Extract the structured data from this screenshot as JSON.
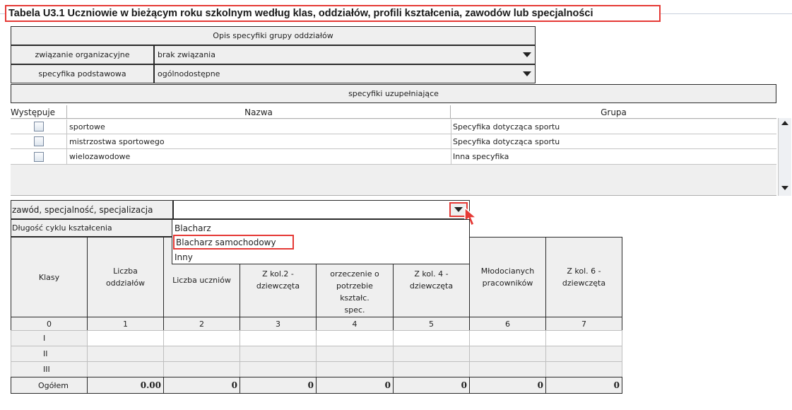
{
  "title": "Tabela U3.1 Uczniowie w bieżącym roku szkolnym według klas, oddziałów, profili kształcenia, zawodów lub specjalności",
  "group_desc": {
    "header": "Opis specyfiki grupy oddziałów",
    "org_label": "związanie organizacyjne",
    "org_value": "brak związania",
    "spec_label": "specyfika podstawowa",
    "spec_value": "ogólnodostępne",
    "supp_header": "specyfiki uzupełniające"
  },
  "spec_table": {
    "columns": [
      "Występuje",
      "Nazwa",
      "Grupa"
    ],
    "rows": [
      {
        "checked": false,
        "name": "sportowe",
        "group": "Specyfika dotycząca sportu"
      },
      {
        "checked": false,
        "name": "mistrzostwa sportowego",
        "group": "Specyfika dotycząca sportu"
      },
      {
        "checked": false,
        "name": "wielozawodowe",
        "group": "Inna specyfika"
      }
    ]
  },
  "profession": {
    "label": "zawód, specjalność, specjalizacja",
    "value": "",
    "cycle_label": "Długość cyklu kształcenia",
    "options": [
      "Blacharz",
      "Blacharz samochodowy",
      "Inny"
    ],
    "highlighted_option": "Blacharz samochodowy"
  },
  "students_table": {
    "headers": [
      "Klasy",
      "Liczba oddziałów",
      "Liczba uczniów",
      "Z kol.2 - dziewczęta",
      "orzeczenie o potrzebie kształc. spec.",
      "Z kol. 4 - dziewczęta",
      "Młodocianych pracowników",
      "Z kol. 6 - dziewczęta"
    ],
    "col_numbers": [
      "0",
      "1",
      "2",
      "3",
      "4",
      "5",
      "6",
      "7"
    ],
    "rows": [
      {
        "label": "I",
        "values": [
          "",
          "",
          "",
          "",
          "",
          "",
          ""
        ]
      },
      {
        "label": "II",
        "values": [
          "",
          "",
          "",
          "",
          "",
          "",
          ""
        ]
      },
      {
        "label": "III",
        "values": [
          "",
          "",
          "",
          "",
          "",
          "",
          ""
        ]
      }
    ],
    "total": {
      "label": "Ogółem",
      "values": [
        "0.00",
        "0",
        "0",
        "0",
        "0",
        "0",
        "0"
      ]
    }
  },
  "colors": {
    "highlight": "#e53935",
    "panel_bg": "#efefef",
    "border": "#2a2a2a"
  }
}
